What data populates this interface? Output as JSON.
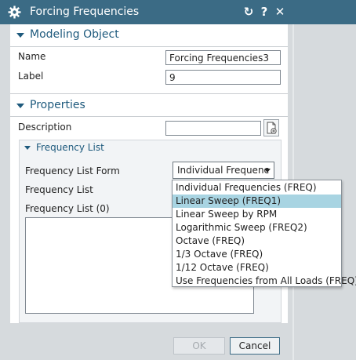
{
  "dialog": {
    "title": "Forcing Frequencies",
    "reset_symbol": "↻",
    "help_symbol": "?",
    "close_symbol": "✕"
  },
  "modeling_object": {
    "heading": "Modeling Object",
    "name_label": "Name",
    "name_value": "Forcing Frequencies3",
    "label_label": "Label",
    "label_value": "9"
  },
  "properties": {
    "heading": "Properties",
    "description_label": "Description",
    "description_value": "",
    "frequency_list_group": {
      "heading": "Frequency List",
      "form_label": "Frequency List Form",
      "form_selected": "Individual Frequenc",
      "list_label": "Frequency List",
      "list_count_label": "Frequency List (0)"
    }
  },
  "dropdown": {
    "options": [
      "Individual Frequencies (FREQ)",
      "Linear Sweep (FREQ1)",
      "Linear Sweep by RPM",
      "Logarithmic Sweep (FREQ2)",
      "Octave (FREQ)",
      "1/3 Octave (FREQ)",
      "1/12 Octave (FREQ)",
      "Use Frequencies from All Loads (FREQ)"
    ],
    "highlighted": "Linear Sweep (FREQ1)"
  },
  "buttons": {
    "ok": "OK",
    "cancel": "Cancel"
  },
  "colors": {
    "titlebar": "#3b6b85",
    "accent": "#1e5a7d",
    "highlight": "#a8d4e2"
  }
}
